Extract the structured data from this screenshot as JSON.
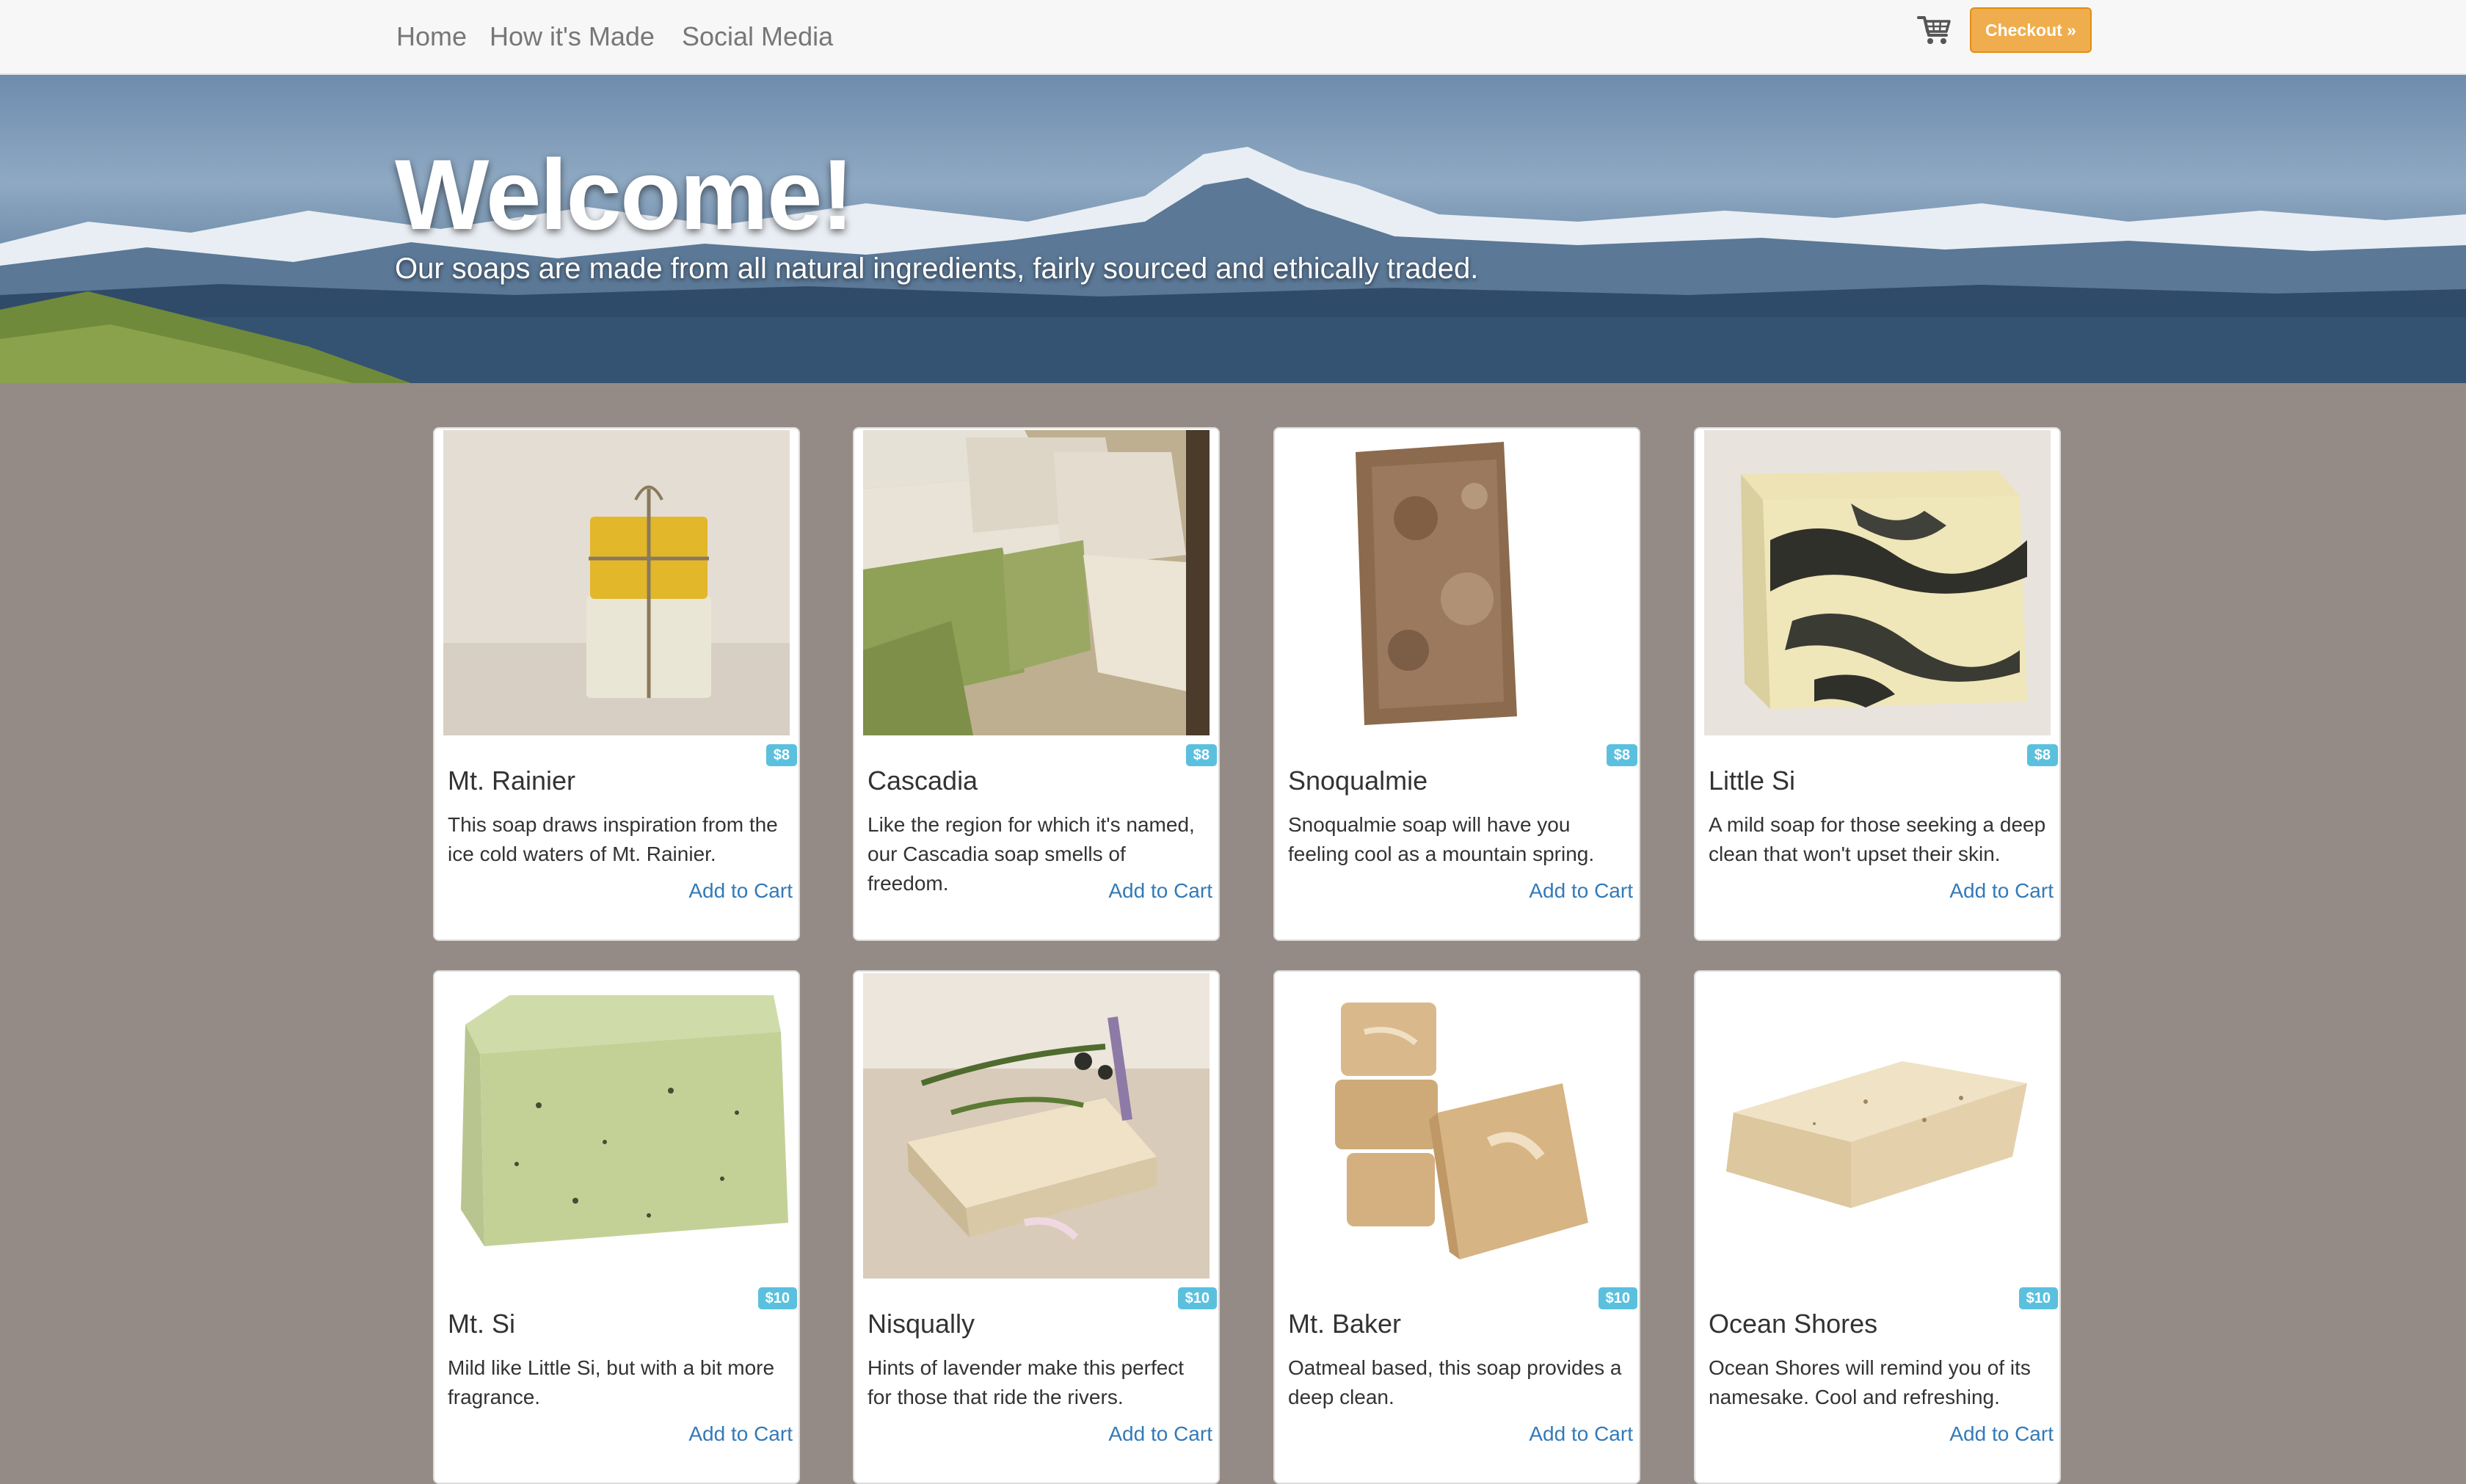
{
  "nav": {
    "links": [
      "Home",
      "How it's Made",
      "Social Media"
    ],
    "cart_icon": "shopping-cart-icon",
    "checkout_label": "Checkout »"
  },
  "hero": {
    "title": "Welcome!",
    "subtitle": "Our soaps are made from all natural ingredients, fairly sourced and ethically traded."
  },
  "colors": {
    "page_bg": "#958b86",
    "badge": "#5bc0de",
    "link": "#337ab7",
    "checkout": "#f0ad4e"
  },
  "products": [
    {
      "name": "Mt. Rainier",
      "price": "$8",
      "description": "This soap draws inspiration from the ice cold waters of Mt. Rainier.",
      "action": "Add to Cart"
    },
    {
      "name": "Cascadia",
      "price": "$8",
      "description": "Like the region for which it's named, our Cascadia soap smells of freedom.",
      "action": "Add to Cart"
    },
    {
      "name": "Snoqualmie",
      "price": "$8",
      "description": "Snoqualmie soap will have you feeling cool as a mountain spring.",
      "action": "Add to Cart"
    },
    {
      "name": "Little Si",
      "price": "$8",
      "description": "A mild soap for those seeking a deep clean that won't upset their skin.",
      "action": "Add to Cart"
    },
    {
      "name": "Mt. Si",
      "price": "$10",
      "description": "Mild like Little Si, but with a bit more fragrance.",
      "action": "Add to Cart"
    },
    {
      "name": "Nisqually",
      "price": "$10",
      "description": "Hints of lavender make this perfect for those that ride the rivers.",
      "action": "Add to Cart"
    },
    {
      "name": "Mt. Baker",
      "price": "$10",
      "description": "Oatmeal based, this soap provides a deep clean.",
      "action": "Add to Cart"
    },
    {
      "name": "Ocean Shores",
      "price": "$10",
      "description": "Ocean Shores will remind you of its namesake. Cool and refreshing.",
      "action": "Add to Cart"
    }
  ]
}
